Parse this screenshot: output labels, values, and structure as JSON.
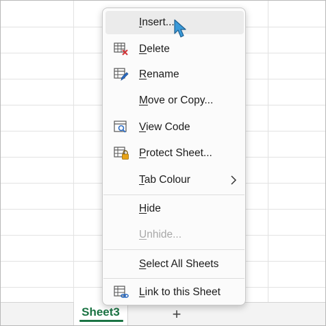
{
  "sheet_tab": {
    "label": "Sheet3"
  },
  "add_sheet": {
    "label": "+"
  },
  "menu": {
    "insert": {
      "pre": "",
      "key": "I",
      "post": "nsert..."
    },
    "delete": {
      "pre": "",
      "key": "D",
      "post": "elete"
    },
    "rename": {
      "pre": "",
      "key": "R",
      "post": "ename"
    },
    "move_copy": {
      "pre": "",
      "key": "M",
      "post": "ove or Copy..."
    },
    "view_code": {
      "pre": "",
      "key": "V",
      "post": "iew Code"
    },
    "protect_sheet": {
      "pre": "",
      "key": "P",
      "post": "rotect Sheet..."
    },
    "tab_colour": {
      "pre": "",
      "key": "T",
      "post": "ab Colour"
    },
    "hide": {
      "pre": "",
      "key": "H",
      "post": "ide"
    },
    "unhide": {
      "pre": "",
      "key": "U",
      "post": "nhide..."
    },
    "select_all": {
      "pre": "",
      "key": "S",
      "post": "elect All Sheets"
    },
    "link_sheet": {
      "pre": "",
      "key": "L",
      "post": "ink to this Sheet"
    }
  },
  "colors": {
    "accent_green": "#1a7343",
    "delete_red": "#d13438",
    "rename_blue": "#2b6cc4",
    "lock_orange": "#e8a317",
    "cursor_blue": "#3a9ad9"
  }
}
